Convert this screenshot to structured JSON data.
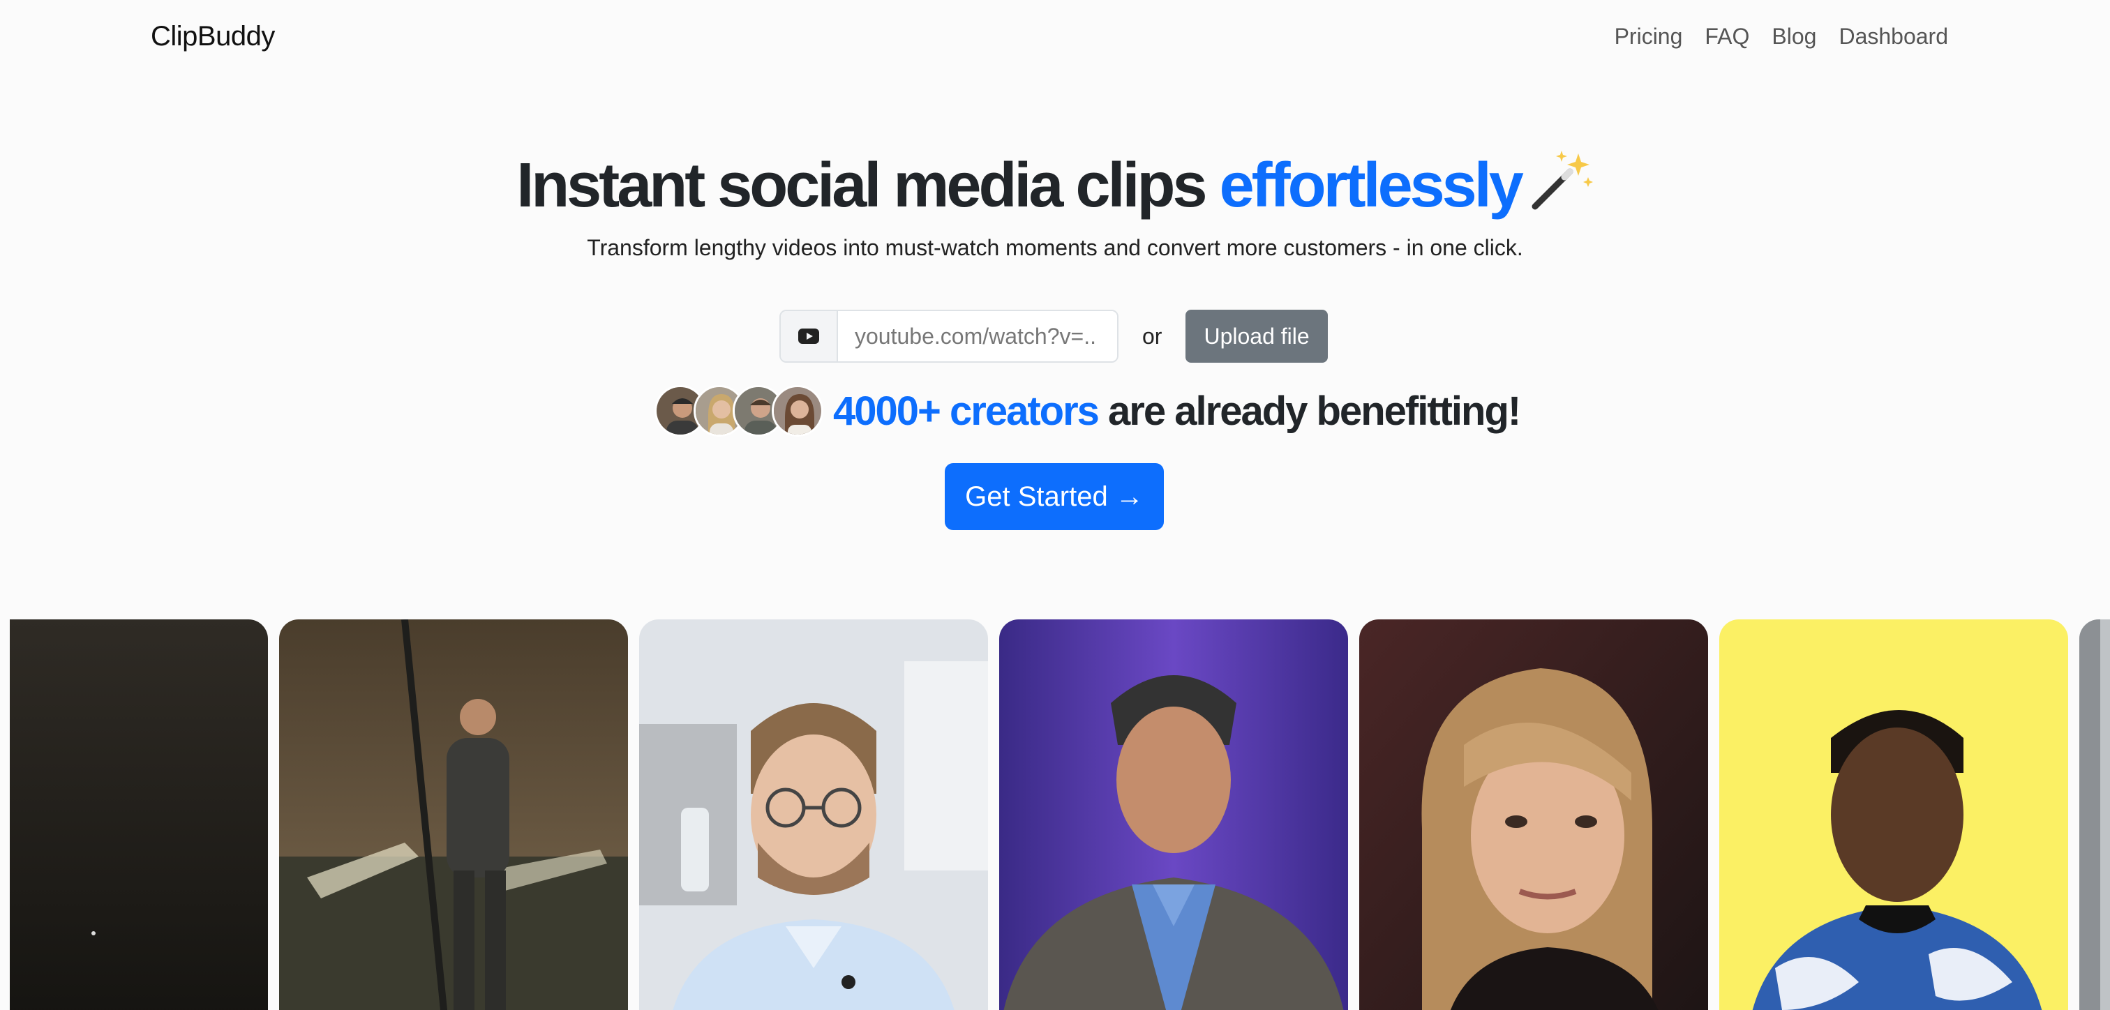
{
  "navbar": {
    "brand": "ClipBuddy",
    "links": [
      "Pricing",
      "FAQ",
      "Blog",
      "Dashboard"
    ]
  },
  "hero": {
    "title_main": "Instant social media clips ",
    "title_accent": "effortlessly",
    "title_icon": "magic-wand-icon",
    "subtitle": "Transform lengthy videos into must-watch moments and convert more customers - in one click."
  },
  "input": {
    "icon": "youtube-icon",
    "placeholder": "youtube.com/watch?v=..",
    "or_label": "or",
    "upload_label": "Upload file"
  },
  "social_proof": {
    "accent": "4000+ creators",
    "rest": " are already benefitting!",
    "avatar_count": 4
  },
  "cta": {
    "label": "Get Started →"
  },
  "colors": {
    "accent": "#0d6efd",
    "secondary_button": "#6c757d",
    "background": "#fbfbfb"
  },
  "clips": [
    "clip-dark-tunnel",
    "clip-sewer-worker",
    "clip-man-glasses",
    "clip-speaker-stage",
    "clip-woman-blonde",
    "clip-man-yellow-bg",
    "clip-partial"
  ]
}
